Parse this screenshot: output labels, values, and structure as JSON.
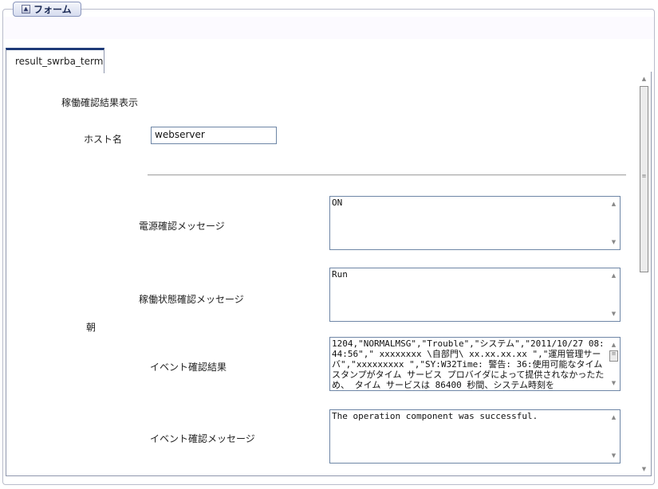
{
  "form": {
    "legend": "フォーム"
  },
  "tab": {
    "label": "result_swrba_term"
  },
  "section_title": "稼働確認結果表示",
  "host": {
    "label": "ホスト名",
    "value": "webserver"
  },
  "time_of_day": "朝",
  "fields": [
    {
      "label": "電源確認メッセージ",
      "value": "ON"
    },
    {
      "label": "稼働状態確認メッセージ",
      "value": "Run"
    },
    {
      "label": "イベント確認結果",
      "value": "1204,\"NORMALMSG\",\"Trouble\",\"システム\",\"2011/10/27 08:44:56\",\" xxxxxxxx \\自部門\\ xx.xx.xx.xx \",\"運用管理サーバ\",\"xxxxxxxxx \",\"SY:W32Time: 警告: 36:使用可能なタイムスタンプがタイム サービス プロバイダによって提供されなかったため、 タイム サービスは 86400 秒間、システム時刻を"
    },
    {
      "label": "イベント確認メッセージ",
      "value": "The operation component was successful."
    }
  ]
}
